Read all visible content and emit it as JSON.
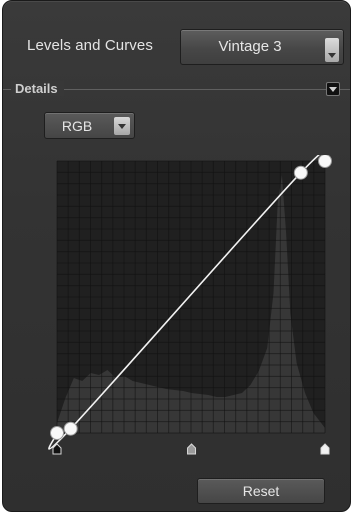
{
  "header": {
    "title": "Levels and Curves",
    "preset_value": "Vintage 3"
  },
  "details": {
    "section_label": "Details",
    "channel_value": "RGB"
  },
  "curve": {
    "control_points": [
      {
        "input": 0,
        "output": 0
      },
      {
        "input": 13,
        "output": 4
      },
      {
        "input": 232,
        "output": 244
      },
      {
        "input": 255,
        "output": 255
      }
    ],
    "input_markers": {
      "black": 0,
      "mid": 128,
      "white": 255
    },
    "colors": {
      "grid_bg": "#202020",
      "grid_line": "#2c2c2c",
      "histogram": "#3a3a3a",
      "curve": "#f2f2f2",
      "point": "#f8f8f8"
    }
  },
  "footer": {
    "reset_label": "Reset"
  },
  "icons": {
    "preset_dropdown": "chevron-down-icon",
    "channel_dropdown": "chevron-down-icon",
    "section_toggle": "collapse-triangle-icon",
    "input_markers": "slider-handle-icon"
  }
}
